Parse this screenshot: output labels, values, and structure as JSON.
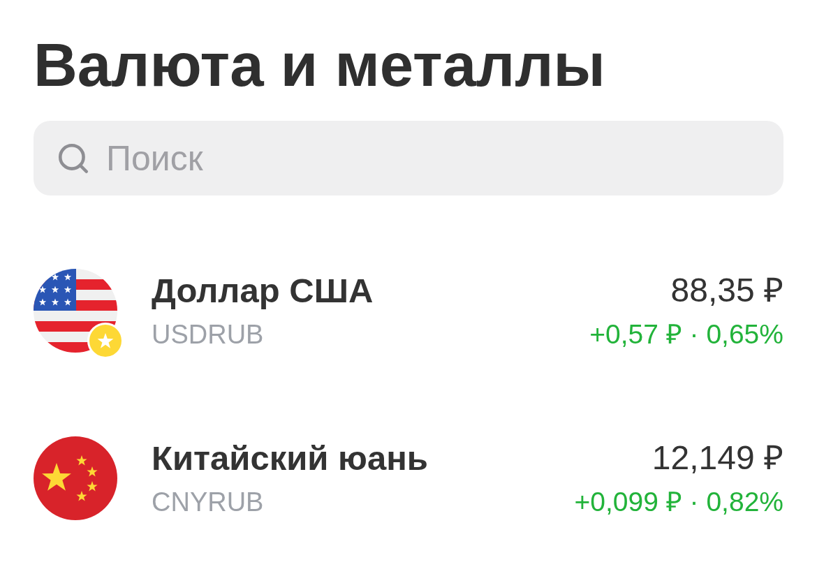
{
  "title": "Валюта и металлы",
  "search": {
    "placeholder": "Поиск"
  },
  "rows": [
    {
      "kind": "usd",
      "favorite": true,
      "name": "Доллар США",
      "code": "USDRUB",
      "price": "88,35 ₽",
      "change": "+0,57 ₽ · 0,65%",
      "rising": true
    },
    {
      "kind": "cny",
      "favorite": false,
      "name": "Китайский юань",
      "code": "CNYRUB",
      "price": "12,149 ₽",
      "change": "+0,099 ₽ · 0,82%",
      "rising": true
    }
  ]
}
